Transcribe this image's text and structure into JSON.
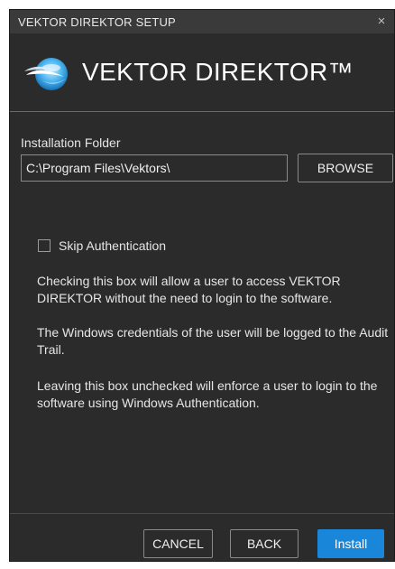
{
  "window": {
    "title": "VEKTOR DIREKTOR SETUP",
    "close_glyph": "×"
  },
  "header": {
    "logo_icon": "vektor-logo-icon",
    "product_title": "VEKTOR DIREKTOR™"
  },
  "folder": {
    "label": "Installation Folder",
    "value": "C:\\Program Files\\Vektors\\",
    "browse_label": "BROWSE"
  },
  "auth": {
    "checkbox_label": "Skip Authentication",
    "checked": false,
    "paragraphs": [
      "Checking this box will allow a user to access VEKTOR DIREKTOR without the need to login to the software.",
      "The Windows credentials of the user will be logged to the Audit Trail.",
      "Leaving this box unchecked will enforce a user to login to the software using Windows Authentication."
    ]
  },
  "footer": {
    "cancel_label": "CANCEL",
    "back_label": "BACK",
    "install_label": "Install"
  },
  "colors": {
    "background": "#2b2b2b",
    "titlebar": "#3a3a3a",
    "accent": "#1a86d9"
  }
}
